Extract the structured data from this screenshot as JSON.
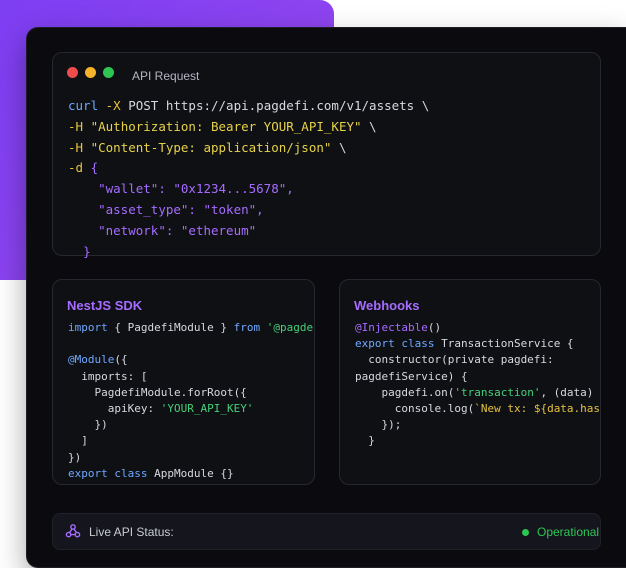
{
  "request": {
    "title": "API Request",
    "lines": [
      "curl -X POST https://api.pagdefi.com/v1/assets \\",
      "-H \"Authorization: Bearer YOUR_API_KEY\" \\",
      "-H \"Content-Type: application/json\" \\",
      "-d {",
      "\"wallet\": \"0x1234...5678\",",
      "\"asset_type\": \"token\",",
      "\"network\": \"ethereum\"",
      "}"
    ]
  },
  "sdk": {
    "title": "NestJS SDK",
    "lines": [
      "import { PagdefiModule } from '@pagdefi/nestjs';",
      "",
      "@Module({",
      "  imports: [",
      "    PagdefiModule.forRoot({",
      "      apiKey: 'YOUR_API_KEY'",
      "    })",
      "  ]",
      "})",
      "export class AppModule {}"
    ]
  },
  "webhooks": {
    "title": "Webhooks",
    "lines": [
      "@Injectable()",
      "export class TransactionService {",
      "  constructor(private pagdefi:",
      "pagdefiService) {",
      "    pagdefi.on('transaction', (data) => {",
      "      console.log(`New tx: ${data.hash}`);",
      "    });",
      "  }"
    ]
  },
  "status": {
    "label": "Live API Status:",
    "value": "Operational",
    "icon": "webhook-icon"
  },
  "colors": {
    "accent": "#a66cff",
    "brand_gradient": "#7d3ef2",
    "status_ok": "#2dc653"
  }
}
